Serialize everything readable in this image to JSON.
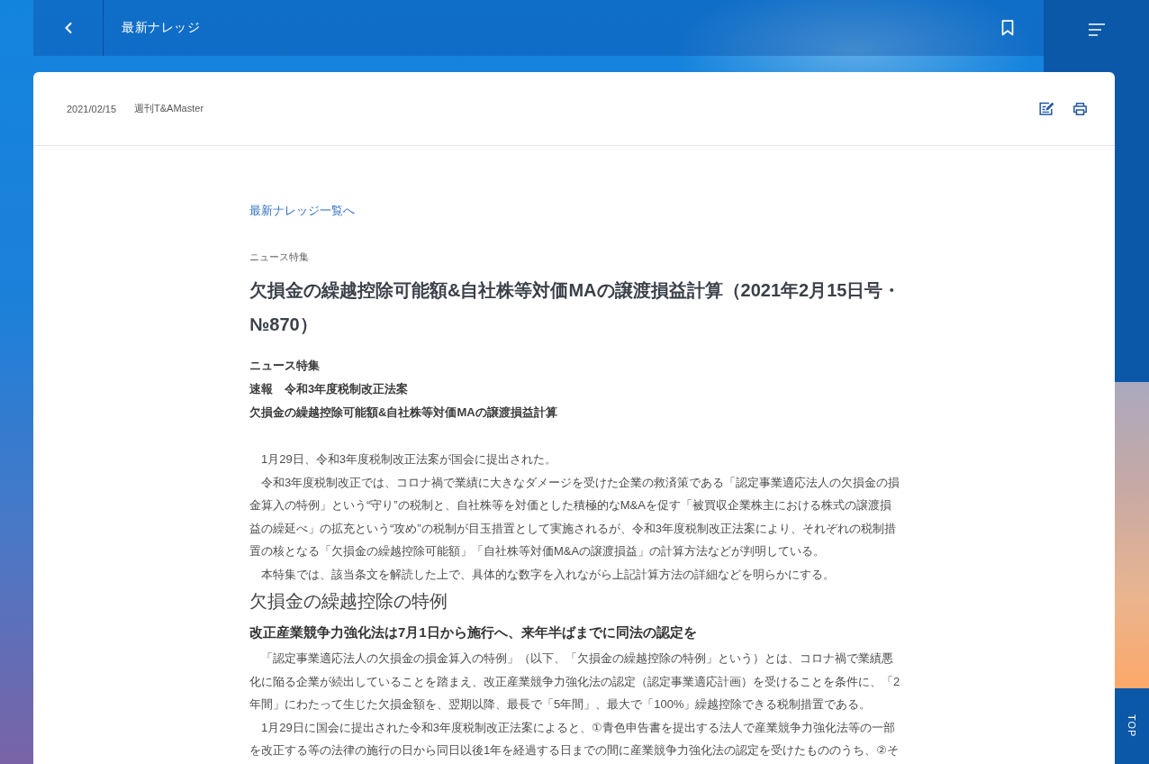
{
  "topbar": {
    "title": "最新ナレッジ"
  },
  "article_header": {
    "date": "2021/02/15",
    "publication": "週刊T&AMaster"
  },
  "article": {
    "back_link": "最新ナレッジ一覧へ",
    "category": "ニュース特集",
    "title": "欠損金の繰越控除可能額&自社株等対価MAの譲渡損益計算（2021年2月15日号・№870）",
    "lead": [
      "ニュース特集",
      "速報　令和3年度税制改正法案",
      "欠損金の繰越控除可能額&自社株等対価MAの譲渡損益計算"
    ],
    "body": [
      {
        "kind": "paragraph",
        "text": "1月29日、令和3年度税制改正法案が国会に提出された。"
      },
      {
        "kind": "paragraph",
        "text": "令和3年度税制改正では、コロナ禍で業績に大きなダメージを受けた企業の救済策である「認定事業適応法人の欠損金の損金算入の特例」という“守り”の税制と、自社株等を対価とした積極的なM&Aを促す「被買収企業株主における株式の譲渡損益の繰延べ」の拡充という“攻め”の税制が目玉措置として実施されるが、令和3年度税制改正法案により、それぞれの税制措置の核となる「欠損金の繰越控除可能額」「自社株等対価M&Aの譲渡損益」の計算方法などが判明している。"
      },
      {
        "kind": "paragraph",
        "text": "本特集では、該当条文を解読した上で、具体的な数字を入れながら上記計算方法の詳細などを明らかにする。"
      },
      {
        "kind": "heading",
        "text": "欠損金の繰越控除の特例"
      },
      {
        "kind": "subheading",
        "text": "改正産業競争力強化法は7月1日から施行へ、来年半ばまでに同法の認定を"
      },
      {
        "kind": "paragraph",
        "text": "「認定事業適応法人の欠損金の損金算入の特例」（以下、「欠損金の繰越控除の特例」という）とは、コロナ禍で業績悪化に陥る企業が続出していることを踏まえ、改正産業競争力強化法の認定（認定事業適応計画）を受けることを条件に、「2年間」にわたって生じた欠損金額を、翌期以降、最長で「5年間」、最大で「100%」繰越控除できる税制措置である。"
      },
      {
        "kind": "paragraph",
        "text": "1月29日に国会に提出された令和3年度税制改正法案によると、①青色申告書を提出する法人で産業競争力強化法等の一部を改正する等の法律の施行の日から同日以後1年を経過する日までの間に産業競争力強化法の認定を受けたもののうち、②そ"
      }
    ]
  },
  "side": {
    "top_button": "TOP"
  }
}
